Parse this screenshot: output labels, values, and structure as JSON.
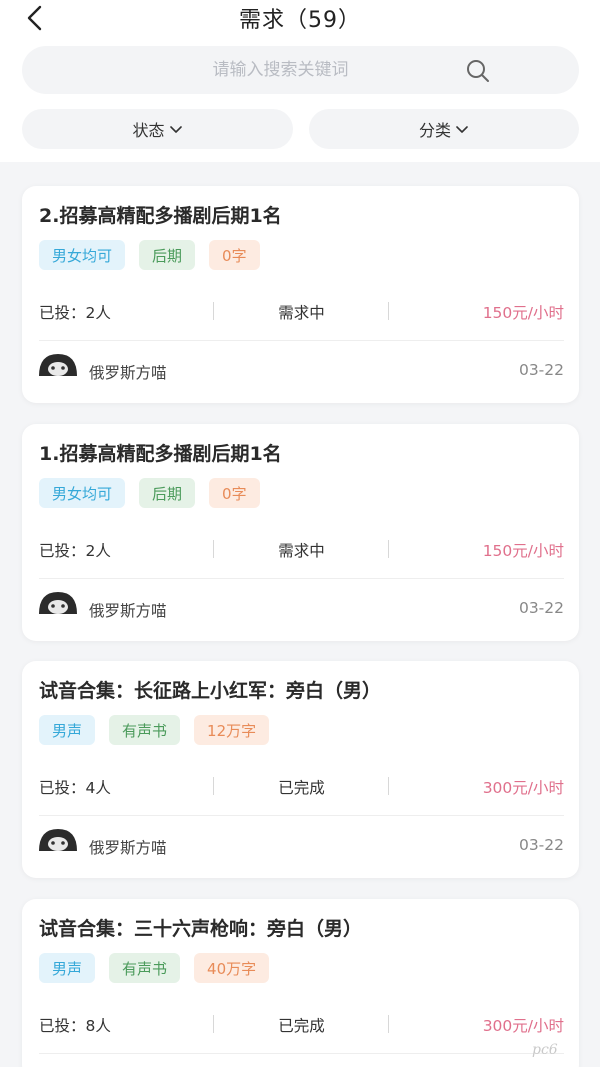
{
  "header": {
    "title": "需求（59）"
  },
  "search": {
    "placeholder": "请输入搜索关键词"
  },
  "filters": [
    {
      "label": "状态"
    },
    {
      "label": "分类"
    }
  ],
  "cards": [
    {
      "title": "2.招募高精配多播剧后期1名",
      "tags": [
        "男女均可",
        "后期",
        "0字"
      ],
      "sent": "已投：2人",
      "status": "需求中",
      "price": "150元/小时",
      "user": "俄罗斯方喵",
      "date": "03-22"
    },
    {
      "title": "1.招募高精配多播剧后期1名",
      "tags": [
        "男女均可",
        "后期",
        "0字"
      ],
      "sent": "已投：2人",
      "status": "需求中",
      "price": "150元/小时",
      "user": "俄罗斯方喵",
      "date": "03-22"
    },
    {
      "title": "试音合集：长征路上小红军：旁白（男）",
      "tags": [
        "男声",
        "有声书",
        "12万字"
      ],
      "sent": "已投：4人",
      "status": "已完成",
      "price": "300元/小时",
      "user": "俄罗斯方喵",
      "date": "03-22"
    },
    {
      "title": "试音合集：三十六声枪响：旁白（男）",
      "tags": [
        "男声",
        "有声书",
        "40万字"
      ],
      "sent": "已投：8人",
      "status": "已完成",
      "price": "300元/小时"
    }
  ],
  "colors": {
    "price": "#e0708c",
    "tag_gender_bg": "#e3f3fb",
    "tag_type_bg": "#e5f2e7",
    "tag_words_bg": "#fdebe1"
  },
  "watermark": "pc6"
}
